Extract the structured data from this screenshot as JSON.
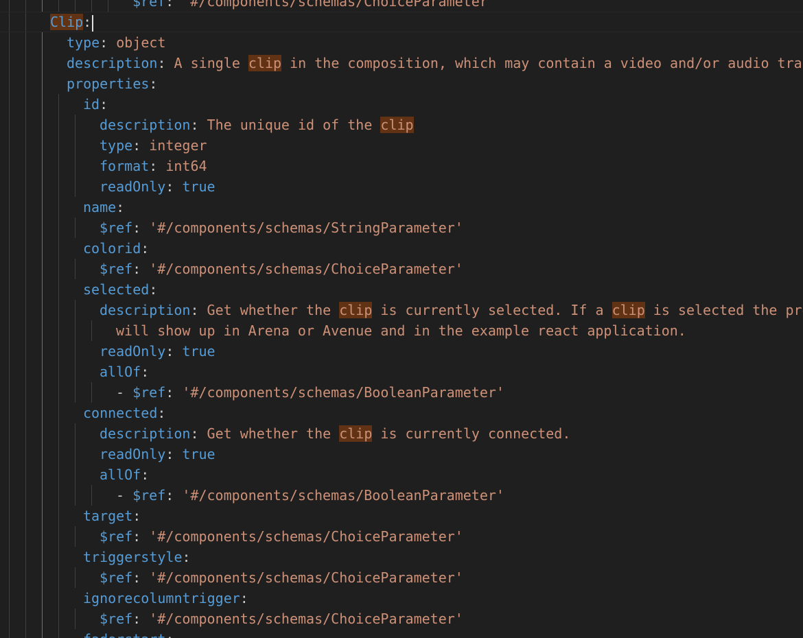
{
  "editor": {
    "lines": [
      {
        "indent": 7,
        "key": "$ref",
        "sep": ": ",
        "value": "'#/components/schemas/ChoiceParameter'"
      },
      {
        "indent": 2,
        "key": "Clip",
        "sep": ":",
        "value": "",
        "cursor": true,
        "keyHighlight": true
      },
      {
        "indent": 3,
        "key": "type",
        "sep": ": ",
        "value": "object"
      },
      {
        "indent": 3,
        "key": "description",
        "sep": ": ",
        "segments": [
          "A single ",
          "clip",
          " in the composition, which may contain a video and/or audio trac"
        ]
      },
      {
        "indent": 3,
        "key": "properties",
        "sep": ":",
        "value": ""
      },
      {
        "indent": 4,
        "key": "id",
        "sep": ":",
        "value": ""
      },
      {
        "indent": 5,
        "key": "description",
        "sep": ": ",
        "segments": [
          "The unique id of the ",
          "clip",
          ""
        ]
      },
      {
        "indent": 5,
        "key": "type",
        "sep": ": ",
        "value": "integer"
      },
      {
        "indent": 5,
        "key": "format",
        "sep": ": ",
        "value": "int64"
      },
      {
        "indent": 5,
        "key": "readOnly",
        "sep": ": ",
        "value": "true",
        "constant": true
      },
      {
        "indent": 4,
        "key": "name",
        "sep": ":",
        "value": ""
      },
      {
        "indent": 5,
        "key": "$ref",
        "sep": ": ",
        "value": "'#/components/schemas/StringParameter'"
      },
      {
        "indent": 4,
        "key": "colorid",
        "sep": ":",
        "value": ""
      },
      {
        "indent": 5,
        "key": "$ref",
        "sep": ": ",
        "value": "'#/components/schemas/ChoiceParameter'"
      },
      {
        "indent": 4,
        "key": "selected",
        "sep": ":",
        "value": ""
      },
      {
        "indent": 5,
        "key": "description",
        "sep": ": ",
        "segments": [
          "Get whether the ",
          "clip",
          " is currently selected. If a ",
          "clip",
          " is selected the pro"
        ]
      },
      {
        "indent": 6,
        "key": "",
        "sep": "",
        "value": "will show up in Arena or Avenue and in the example react application."
      },
      {
        "indent": 5,
        "key": "readOnly",
        "sep": ": ",
        "value": "true",
        "constant": true
      },
      {
        "indent": 5,
        "key": "allOf",
        "sep": ":",
        "value": ""
      },
      {
        "indent": 6,
        "dash": true,
        "key": "$ref",
        "sep": ": ",
        "value": "'#/components/schemas/BooleanParameter'"
      },
      {
        "indent": 4,
        "key": "connected",
        "sep": ":",
        "value": ""
      },
      {
        "indent": 5,
        "key": "description",
        "sep": ": ",
        "segments": [
          "Get whether the ",
          "clip",
          " is currently connected."
        ]
      },
      {
        "indent": 5,
        "key": "readOnly",
        "sep": ": ",
        "value": "true",
        "constant": true
      },
      {
        "indent": 5,
        "key": "allOf",
        "sep": ":",
        "value": ""
      },
      {
        "indent": 6,
        "dash": true,
        "key": "$ref",
        "sep": ": ",
        "value": "'#/components/schemas/BooleanParameter'"
      },
      {
        "indent": 4,
        "key": "target",
        "sep": ":",
        "value": ""
      },
      {
        "indent": 5,
        "key": "$ref",
        "sep": ": ",
        "value": "'#/components/schemas/ChoiceParameter'"
      },
      {
        "indent": 4,
        "key": "triggerstyle",
        "sep": ":",
        "value": ""
      },
      {
        "indent": 5,
        "key": "$ref",
        "sep": ": ",
        "value": "'#/components/schemas/ChoiceParameter'"
      },
      {
        "indent": 4,
        "key": "ignorecolumntrigger",
        "sep": ":",
        "value": ""
      },
      {
        "indent": 5,
        "key": "$ref",
        "sep": ": ",
        "value": "'#/components/schemas/ChoiceParameter'"
      },
      {
        "indent": 4,
        "key": "faderstart",
        "sep": ":",
        "value": ""
      }
    ]
  },
  "colors": {
    "background": "#1f1f1f",
    "key": "#569cd6",
    "string": "#ce9178",
    "constant": "#569cd6",
    "punctuation": "#cccccc",
    "match_highlight": "#613214",
    "indent_guide": "#404040"
  }
}
